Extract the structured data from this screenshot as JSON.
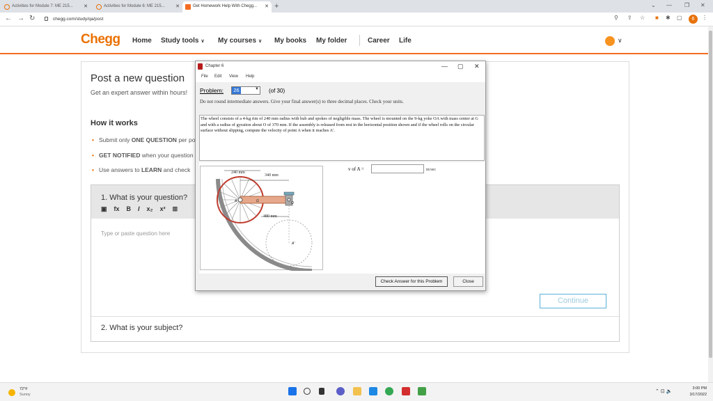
{
  "browser": {
    "tabs": [
      {
        "title": "Activities for Module 7: ME 215..."
      },
      {
        "title": "Activities for Module 6: ME 215..."
      },
      {
        "title": "Get Homework Help With Chegg..."
      }
    ],
    "url": "chegg.com/study/qa/post",
    "profile_initial": "6"
  },
  "header": {
    "logo": "Chegg",
    "nav": {
      "home": "Home",
      "study_tools": "Study tools",
      "my_courses": "My courses",
      "my_books": "My books",
      "my_folder": "My folder",
      "career": "Career",
      "life": "Life"
    }
  },
  "page": {
    "post_title": "Post a new question",
    "post_subtitle": "Get an expert answer within hours!",
    "how_it_works": "How it works",
    "how_items": [
      {
        "pre": "Submit only ",
        "bold": "ONE QUESTION",
        "post": " per post"
      },
      {
        "pre": "",
        "bold": "GET NOTIFIED",
        "post": " when your question is answered"
      },
      {
        "pre": "Use answers to ",
        "bold": "LEARN",
        "post": " and check"
      }
    ],
    "q1_title": "1. What is your question?",
    "q1_placeholder": "Type or paste question here",
    "continue": "Continue",
    "q2_title": "2. What is your subject?"
  },
  "dialog": {
    "title": "Chapter 6",
    "menu": {
      "file": "File",
      "edit": "Edit",
      "view": "View",
      "help": "Help"
    },
    "problem_label": "Problem:",
    "problem_number": "26",
    "problem_of": "(of 30)",
    "instructions": "Do not round intermediate answers.  Give your final answer(s) to three decimal places.  Check your units.",
    "problem_text": "The wheel consists of a 4-kg rim of 240 mm radius with hub and spokes of negligible mass. The wheel is mounted on the 9-kg yoke OA with mass center at G and with a radius of gyration about O of 370 mm. If the assembly is released from rest in the horizontal position shown and if the wheel rolls on the circular surface without slipping, compute the velocity of point A when it reaches A'.",
    "figure": {
      "dim1": "240 mm",
      "dim2": "340 mm",
      "dim3": "480 mm",
      "label_A": "A",
      "label_G": "G",
      "label_O": "O",
      "label_Aprime": "A'"
    },
    "answer_label": "v of A =",
    "answer_value": "",
    "answer_unit": "m/sec",
    "check_button": "Check Answer for this Problem",
    "close_button": "Close"
  },
  "taskbar": {
    "temp": "72°F",
    "weather": "Sunny",
    "time": "3:00 PM",
    "date": "3/17/2022"
  }
}
